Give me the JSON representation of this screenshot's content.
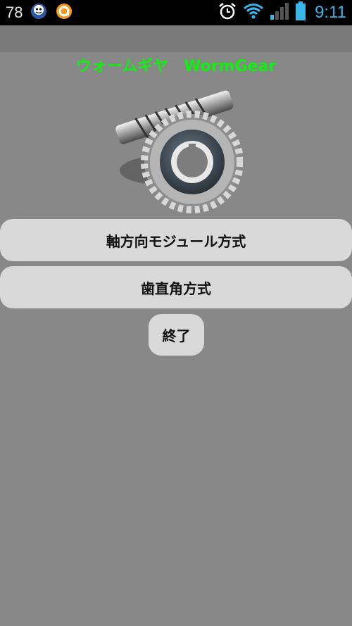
{
  "status_bar": {
    "notification_count": "78",
    "time": "9:11",
    "icons": [
      "app-notification-icon",
      "orange-app-icon",
      "alarm-clock-icon",
      "wifi-icon",
      "signal-icon",
      "battery-icon"
    ]
  },
  "app": {
    "title": "ウォームギヤ　WormGear",
    "image": "worm-gear-image"
  },
  "buttons": {
    "axial_module": "軸方向モジュール方式",
    "normal_module": "歯直角方式",
    "exit": "終了"
  }
}
